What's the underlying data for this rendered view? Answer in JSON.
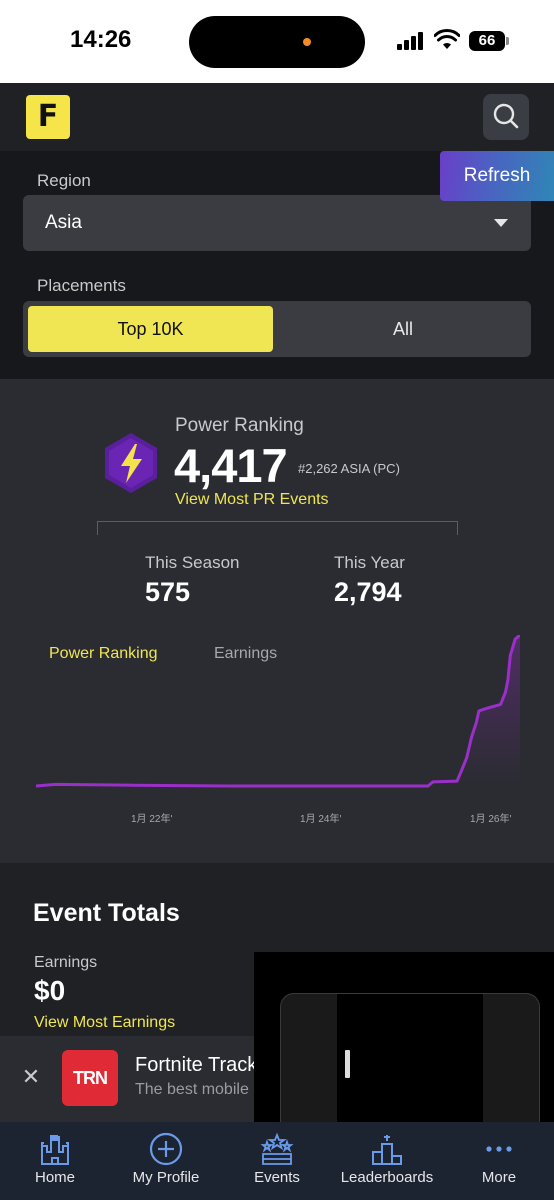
{
  "status_bar": {
    "time": "14:26",
    "battery": "66"
  },
  "header": {
    "logo_letter": "F"
  },
  "filters": {
    "region_label": "Region",
    "region_value": "Asia",
    "refresh_label": "Refresh",
    "placements_label": "Placements",
    "placements_options": [
      "Top 10K",
      "All"
    ],
    "placements_selected": "Top 10K"
  },
  "power_ranking": {
    "label": "Power Ranking",
    "value": "4,417",
    "rank": "#2,262 ASIA (PC)",
    "link": "View Most PR Events",
    "this_season_label": "This Season",
    "this_season_value": "575",
    "this_year_label": "This Year",
    "this_year_value": "2,794",
    "tabs": [
      "Power Ranking",
      "Earnings"
    ],
    "active_tab": "Power Ranking"
  },
  "chart_data": {
    "type": "line",
    "x_ticks": [
      "1月 22年'",
      "1月 24年'",
      "1月 26年'"
    ],
    "series": [
      {
        "color": "#9b2fc9",
        "points": [
          [
            0,
            0
          ],
          [
            0.04,
            2
          ],
          [
            0.2,
            1
          ],
          [
            0.4,
            0
          ],
          [
            0.6,
            0
          ],
          [
            0.75,
            0
          ],
          [
            0.81,
            0
          ],
          [
            0.82,
            5
          ],
          [
            0.87,
            6
          ],
          [
            0.88,
            20
          ],
          [
            0.89,
            35
          ],
          [
            0.9,
            60
          ],
          [
            0.91,
            78
          ],
          [
            0.915,
            92
          ],
          [
            0.93,
            95
          ],
          [
            0.96,
            100
          ],
          [
            0.97,
            115
          ],
          [
            0.975,
            130
          ],
          [
            0.98,
            160
          ],
          [
            0.99,
            180
          ],
          [
            1.0,
            185
          ]
        ]
      }
    ],
    "grid": false,
    "legend": "none"
  },
  "event_totals": {
    "title": "Event Totals",
    "earnings_label": "Earnings",
    "earnings_value": "$0",
    "earnings_link": "View Most Earnings"
  },
  "ad": {
    "logo_text": "TRN",
    "title": "Fortnite Track",
    "subtitle": "The best mobile"
  },
  "nav": {
    "items": [
      "Home",
      "My Profile",
      "Events",
      "Leaderboards",
      "More"
    ]
  },
  "colors": {
    "accent_yellow": "#f0e553",
    "chart_purple": "#9b2fc9",
    "nav_icon_blue": "#6b9be8"
  }
}
